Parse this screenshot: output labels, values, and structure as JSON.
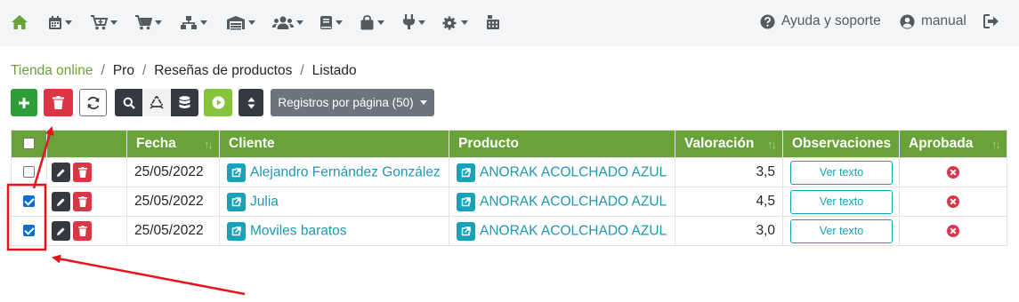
{
  "navbar": {
    "icons": [
      "home-icon",
      "calendar-icon",
      "cart-plus-icon",
      "cart-icon",
      "sitemap-icon",
      "warehouse-icon",
      "users-icon",
      "book-icon",
      "bag-icon",
      "plug-icon",
      "cogs-icon",
      "calculator-icon"
    ],
    "help_label": "Ayuda y soporte",
    "user_label": "manual"
  },
  "breadcrumb": {
    "root": "Tienda online",
    "items": [
      "Pro",
      "Reseñas de productos",
      "Listado"
    ]
  },
  "toolbar": {
    "per_page_label": "Registros por página (50)"
  },
  "table": {
    "headers": {
      "date": "Fecha",
      "client": "Cliente",
      "product": "Producto",
      "rating": "Valoración",
      "observations": "Observaciones",
      "approved": "Aprobada"
    },
    "view_text_label": "Ver texto",
    "rows": [
      {
        "checked": false,
        "date": "25/05/2022",
        "client": "Alejandro Fernández González",
        "product": "ANORAK ACOLCHADO AZUL",
        "rating": "3,5",
        "approved": false
      },
      {
        "checked": true,
        "date": "25/05/2022",
        "client": "Julia",
        "product": "ANORAK ACOLCHADO AZUL",
        "rating": "4,5",
        "approved": false
      },
      {
        "checked": true,
        "date": "25/05/2022",
        "client": "Moviles baratos",
        "product": "ANORAK ACOLCHADO AZUL",
        "rating": "3,0",
        "approved": false
      }
    ]
  },
  "colors": {
    "accent_green": "#6aa23a",
    "danger": "#dc3545",
    "info": "#17a2b8",
    "annotation_red": "#e8141b"
  }
}
